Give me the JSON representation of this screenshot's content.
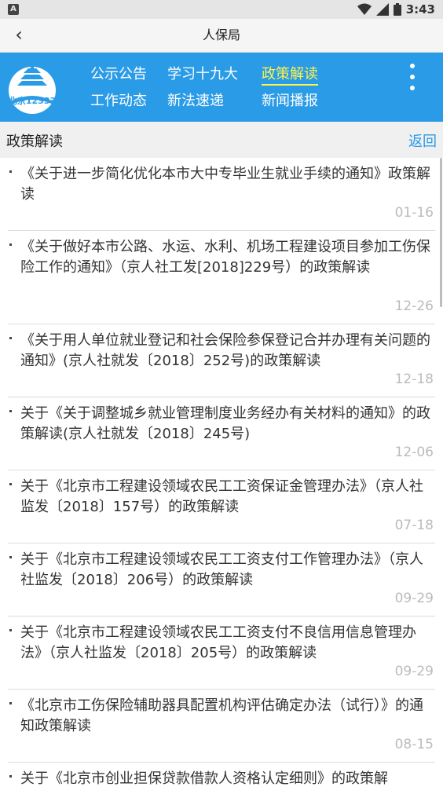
{
  "status_bar": {
    "notification_icon": "A",
    "time": "3:43"
  },
  "title_bar": {
    "back_icon": "‹",
    "title": "人保局"
  },
  "nav": {
    "logo_text": "北京12333",
    "row1": [
      "公示公告",
      "学习十九大",
      "政策解读"
    ],
    "row2": [
      "工作动态",
      "新法速递",
      "新闻播报"
    ],
    "active": "政策解读"
  },
  "section": {
    "label": "政策解读",
    "back_label": "返回"
  },
  "articles": [
    {
      "title": "《关于进一步简化优化本市大中专毕业生就业手续的通知》政策解读",
      "date": "01-16"
    },
    {
      "title": "《关于做好本市公路、水运、水利、机场工程建设项目参加工伤保险工作的通知》（京人社工发[2018]229号）的政策解读",
      "date": "12-26"
    },
    {
      "title": "《关于用人单位就业登记和社会保险参保登记合并办理有关问题的通知》(京人社就发〔2018〕252号)的政策解读",
      "date": "12-18"
    },
    {
      "title": "关于《关于调整城乡就业管理制度业务经办有关材料的通知》的政策解读(京人社就发〔2018〕245号)",
      "date": "12-06"
    },
    {
      "title": "关于《北京市工程建设领域农民工工资保证金管理办法》（京人社监发〔2018〕157号）的政策解读",
      "date": "07-18"
    },
    {
      "title": "关于《北京市工程建设领域农民工工资支付工作管理办法》（京人社监发〔2018〕206号）的政策解读",
      "date": "09-29"
    },
    {
      "title": "关于《北京市工程建设领域农民工工资支付不良信用信息管理办法》（京人社监发〔2018〕205号）的政策解读",
      "date": "09-29"
    },
    {
      "title": "《北京市工伤保险辅助器具配置机构评估确定办法（试行）》的通知政策解读",
      "date": "08-15"
    },
    {
      "title": "关于《北京市创业担保贷款借款人资格认定细则》的政策解",
      "date": ""
    }
  ]
}
